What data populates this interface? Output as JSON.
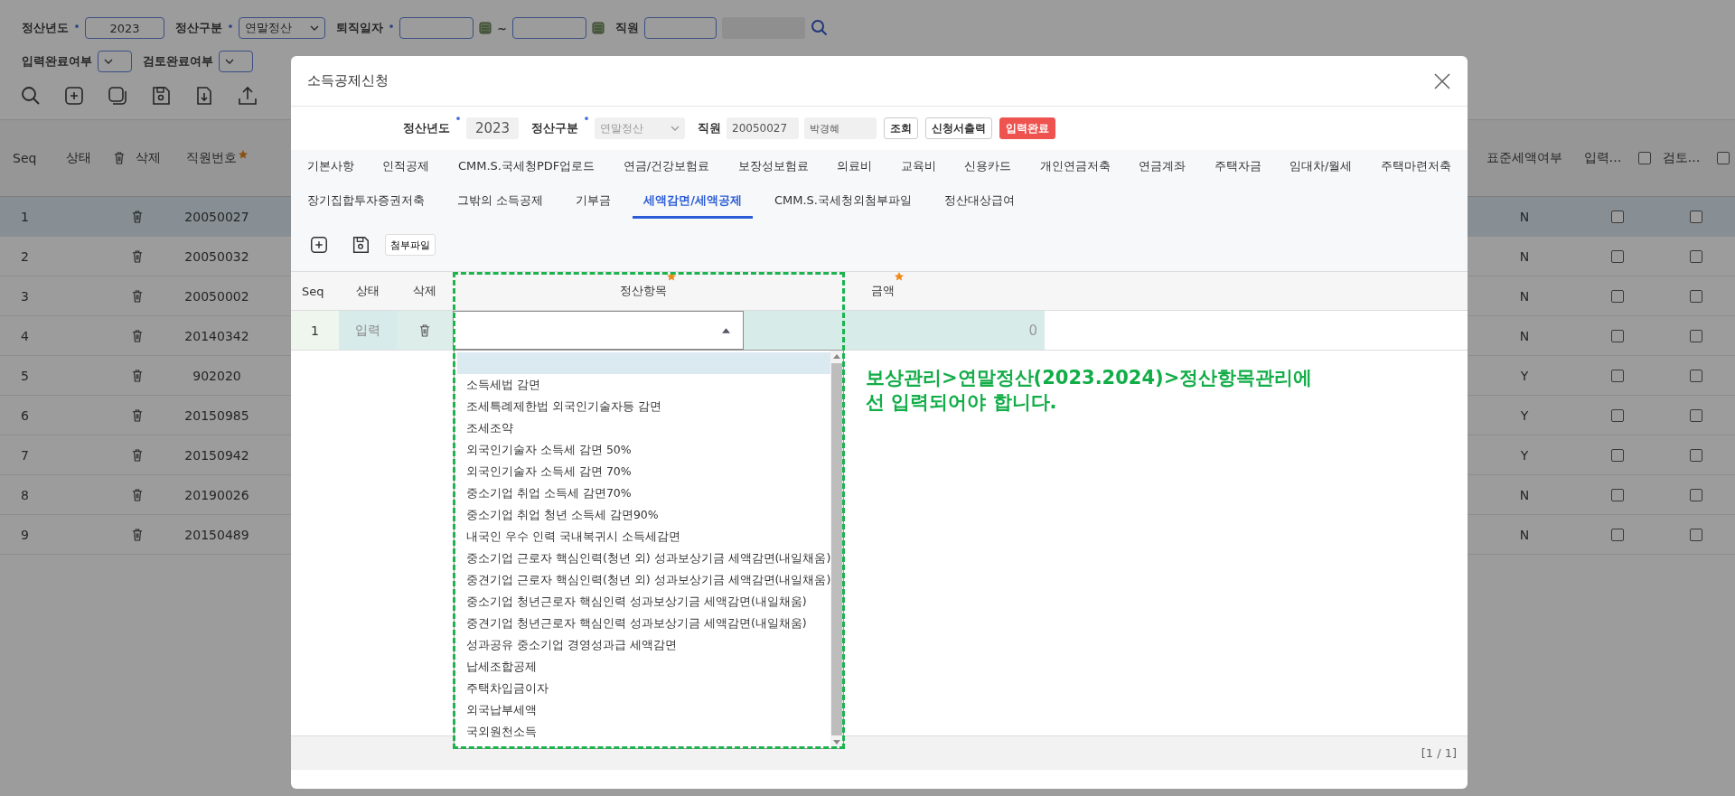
{
  "search_filters": {
    "row_1": [
      {
        "kind": "text",
        "label": "정산년도",
        "required": true,
        "value": "2023"
      },
      {
        "kind": "select",
        "label": "정산구분",
        "required": true,
        "value": "연말정산"
      },
      {
        "kind": "date_range",
        "label": "퇴직일자",
        "required": true,
        "separator": "~"
      },
      {
        "kind": "employee",
        "label": "직원",
        "required": false
      }
    ],
    "row_2": [
      {
        "label": "입력완료여부"
      },
      {
        "label": "검토완료여부"
      }
    ]
  },
  "main_table": {
    "columns_left": [
      "Seq",
      "상태",
      "삭제",
      "직원번호"
    ],
    "columns_right": [
      {
        "label": "표준세액여부",
        "kind": "text"
      },
      {
        "label": "입력…",
        "kind": "check",
        "checked": false
      },
      {
        "label": "검토…",
        "kind": "check",
        "checked": false
      }
    ],
    "rows": [
      {
        "seq": "1",
        "employee_no": "20050027",
        "standard_tax": "N",
        "input_done": false,
        "review_done": false,
        "selected": true
      },
      {
        "seq": "2",
        "employee_no": "20050032",
        "standard_tax": "N",
        "input_done": false,
        "review_done": false,
        "selected": false
      },
      {
        "seq": "3",
        "employee_no": "20050002",
        "standard_tax": "N",
        "input_done": false,
        "review_done": false,
        "selected": false
      },
      {
        "seq": "4",
        "employee_no": "20140342",
        "standard_tax": "N",
        "input_done": false,
        "review_done": false,
        "selected": false
      },
      {
        "seq": "5",
        "employee_no": "902020",
        "standard_tax": "Y",
        "input_done": false,
        "review_done": false,
        "selected": false
      },
      {
        "seq": "6",
        "employee_no": "20150985",
        "standard_tax": "Y",
        "input_done": false,
        "review_done": false,
        "selected": false
      },
      {
        "seq": "7",
        "employee_no": "20150942",
        "standard_tax": "Y",
        "input_done": false,
        "review_done": false,
        "selected": false
      },
      {
        "seq": "8",
        "employee_no": "20190026",
        "standard_tax": "N",
        "input_done": false,
        "review_done": false,
        "selected": false
      },
      {
        "seq": "9",
        "employee_no": "20150489",
        "standard_tax": "N",
        "input_done": false,
        "review_done": false,
        "selected": false
      }
    ]
  },
  "dialog": {
    "title": "소득공제신청",
    "filters": {
      "year_label": "정산년도",
      "year": "2023",
      "type_label": "정산구분",
      "type": "연말정산",
      "employee_label": "직원",
      "employee_no": "20050027",
      "employee_name": "박경혜"
    },
    "buttons": [
      {
        "label": "조회",
        "kind": "default"
      },
      {
        "label": "신청서출력",
        "kind": "default"
      },
      {
        "label": "입력완료",
        "kind": "danger"
      }
    ],
    "tab_rows": [
      [
        {
          "label": "기본사항",
          "selected": false
        },
        {
          "label": "인적공제",
          "selected": false
        },
        {
          "label": "CMM.S.국세청PDF업로드",
          "selected": false
        },
        {
          "label": "연금/건강보험료",
          "selected": false
        },
        {
          "label": "보장성보험료",
          "selected": false
        },
        {
          "label": "의료비",
          "selected": false
        },
        {
          "label": "교육비",
          "selected": false
        },
        {
          "label": "신용카드",
          "selected": false
        },
        {
          "label": "개인연금저축",
          "selected": false
        },
        {
          "label": "연금계좌",
          "selected": false
        },
        {
          "label": "주택자금",
          "selected": false
        },
        {
          "label": "임대차/월세",
          "selected": false
        },
        {
          "label": "주택마련저축",
          "selected": false
        }
      ],
      [
        {
          "label": "장기집합투자증권저축",
          "selected": false
        },
        {
          "label": "그밖의 소득공제",
          "selected": false
        },
        {
          "label": "기부금",
          "selected": false
        },
        {
          "label": "세액감면/세액공제",
          "selected": true
        },
        {
          "label": "CMM.S.국세청외첨부파일",
          "selected": false
        },
        {
          "label": "정산대상급여",
          "selected": false
        }
      ]
    ],
    "attach_button": "첨부파일",
    "grid": {
      "columns": [
        {
          "label": "Seq",
          "required": false
        },
        {
          "label": "상태",
          "required": false
        },
        {
          "label": "삭제",
          "required": false
        },
        {
          "label": "정산항목",
          "required": true
        },
        {
          "label": "금액",
          "required": true
        }
      ],
      "rows": [
        {
          "seq": "1",
          "status": "입력",
          "amount": "0"
        }
      ],
      "dropdown": {
        "expanded": true,
        "blank_highlighted": true,
        "options": [
          "소득세법 감면",
          "조세특례제한법 외국인기술자등 감면",
          "조세조약",
          "외국인기술자 소득세 감면 50%",
          "외국인기술자 소득세 감면 70%",
          "중소기업 취업 소득세 감면70%",
          "중소기업 취업 청년 소득세 감면90%",
          "내국인 우수 인력 국내복귀시 소득세감면",
          "중소기업 근로자 핵심인력(청년 외) 성과보상기금 세액감면(내일채움)",
          "중견기업 근로자 핵심인력(청년 외) 성과보상기금 세액감면(내일채움)",
          "중소기업 청년근로자 핵심인력 성과보상기금 세액감면(내일채움)",
          "중견기업 청년근로자 핵심인력 성과보상기금 세액감면(내일채움)",
          "성과공유 중소기업 경영성과급 세액감면",
          "납세조합공제",
          "주택차입금이자",
          "외국납부세액",
          "국외원천소득"
        ]
      },
      "pager": "[1 / 1]"
    },
    "note": "보상관리>연말정산(2023.2024)>정산항목관리에\n선 입력되어야 합니다."
  }
}
